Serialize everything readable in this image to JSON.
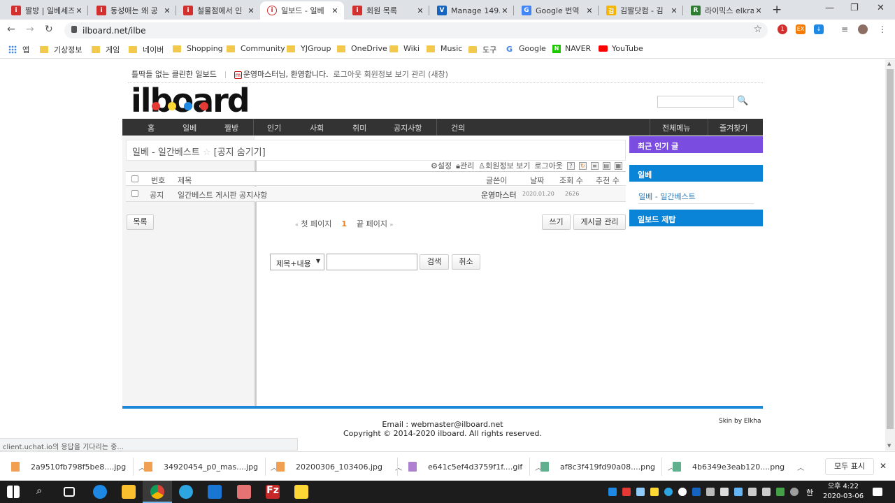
{
  "browser": {
    "tabs": [
      {
        "title": "짤방 | 일베세즈",
        "fav_color": "#d32f2f"
      },
      {
        "title": "동성애는 왜 공",
        "fav_color": "#d32f2f"
      },
      {
        "title": "철물점에서 인",
        "fav_color": "#d32f2f"
      },
      {
        "title": "일보드 - 일베",
        "fav_color": "#d32f2f"
      },
      {
        "title": "회원 목록",
        "fav_color": "#d32f2f"
      },
      {
        "title": "Manage 149.2",
        "fav_color": "#1565c0"
      },
      {
        "title": "Google 번역",
        "fav_color": "#4285f4"
      },
      {
        "title": "김짤닷컴 - 김",
        "fav_color": "#f4b400"
      },
      {
        "title": "라이믹스 elkra",
        "fav_color": "#2e7d32"
      }
    ],
    "url": "ilboard.net/ilbe",
    "bookmarks": [
      "앱",
      "기상정보",
      "게임",
      "네이버",
      "Shopping",
      "Community",
      "YJGroup",
      "OneDrive",
      "Wiki",
      "Music",
      "도구",
      "Google",
      "NAVER",
      "YouTube"
    ]
  },
  "site": {
    "slogan": "틀딱들 없는 클린한 일보드",
    "user_name": "운영마스터",
    "welcome": "님, 환영합니다.",
    "links": "로그아웃  회원정보 보기  관리 (새창)",
    "logo_text": "ilboard",
    "nav": [
      "홈",
      "일베",
      "짤방",
      "인기",
      "사회",
      "취미",
      "공지사항",
      "건의"
    ],
    "nav_right": [
      "전체메뉴",
      "즐겨찾기"
    ]
  },
  "board": {
    "title": "일베 - 일간베스트",
    "star": "☆",
    "notice_toggle": "[공지 숨기기]",
    "tools": {
      "settings": "설정",
      "manage": "관리",
      "member": "회원정보 보기",
      "logout": "로그아웃",
      "help": "?"
    },
    "columns": {
      "no": "번호",
      "title": "제목",
      "author": "글쓴이",
      "date": "날짜",
      "views": "조회 수",
      "votes": "추천 수"
    },
    "rows": [
      {
        "no": "공지",
        "title": "일간베스트 게시판 공지사항",
        "author": "운영마스터",
        "date": "2020.01.20",
        "views": "2626",
        "votes": ""
      }
    ],
    "list_button": "목록",
    "pager": {
      "first": "첫 페이지",
      "current": "1",
      "last": "끝 페이지"
    },
    "write_button": "쓰기",
    "manage_button": "게시글 관리",
    "search": {
      "option": "제목+내용",
      "value": "",
      "search_button": "검색",
      "cancel_button": "취소"
    }
  },
  "sidebar": {
    "recent_title": "최근 인기 글",
    "ilbe_title": "일베",
    "ilbe_link": "일베 - 일간베스트",
    "report_title": "일보드 제탑",
    "colors": {
      "recent": "#7b4ce0",
      "ilbe": "#0a84d6",
      "report": "#0a84d6"
    }
  },
  "footer": {
    "email": "Email : webmaster@ilboard.net",
    "copyright": "Copyright © 2014-2020 ilboard. All rights reserved.",
    "skin": "Skin by Elkha"
  },
  "status_text": "client.uchat.io의 응답을 기다리는 중...",
  "downloads": [
    {
      "name": "2a9510fb798f5be8....jpg",
      "color": "#f0a050"
    },
    {
      "name": "34920454_p0_mas....jpg",
      "color": "#f0a050"
    },
    {
      "name": "20200306_103406.jpg",
      "color": "#f0a050"
    },
    {
      "name": "e641c5ef4d3759f1f....gif",
      "color": "#b080d0"
    },
    {
      "name": "af8c3f419fd90a08....png",
      "color": "#60b090"
    },
    {
      "name": "4b6349e3eab120....png",
      "color": "#60b090"
    }
  ],
  "show_all": "모두 표시",
  "taskbar": {
    "clock_period": "오후 4:22",
    "clock_date": "2020-03-06",
    "ime": "한"
  }
}
